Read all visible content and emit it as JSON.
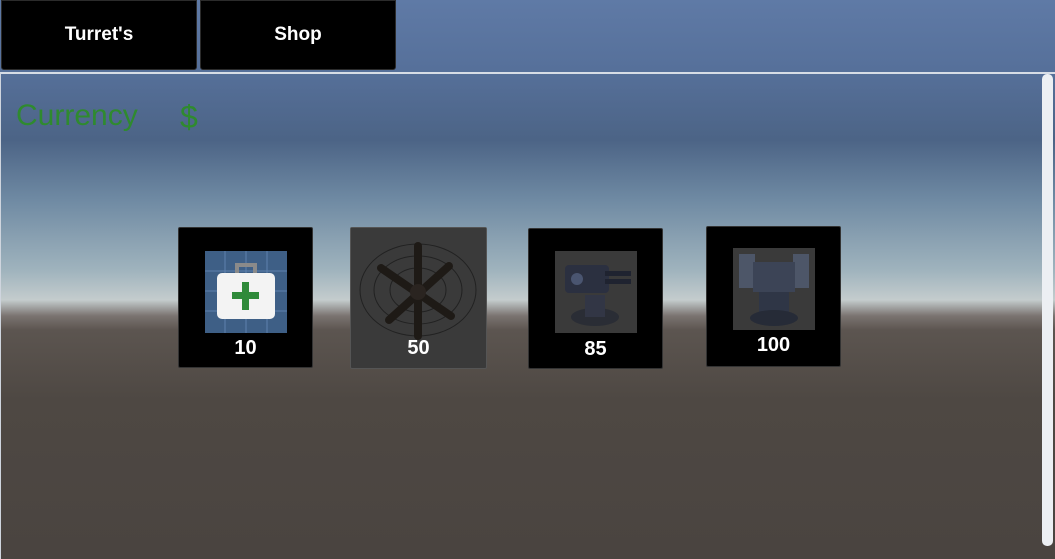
{
  "tabs": [
    {
      "label": "Turret's"
    },
    {
      "label": "Shop"
    }
  ],
  "currency": {
    "label": "Currency",
    "symbol": "$"
  },
  "shop_items": [
    {
      "icon": "medkit-icon",
      "price": "10"
    },
    {
      "icon": "crossbar-turret-icon",
      "price": "50"
    },
    {
      "icon": "gatling-turret-icon",
      "price": "85"
    },
    {
      "icon": "heavy-turret-icon",
      "price": "100"
    }
  ],
  "colors": {
    "currency_text": "#2f8a2f",
    "tab_bg": "#000000",
    "card_bg": "#000000"
  }
}
